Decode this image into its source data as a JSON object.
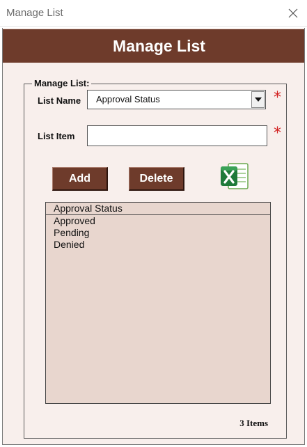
{
  "window": {
    "title": "Manage List"
  },
  "form": {
    "header": "Manage List",
    "group_label": "Manage List:",
    "list_name_label": "List Name",
    "list_name_value": "Approval Status",
    "list_item_label": "List Item",
    "list_item_value": "",
    "required_mark": "*",
    "add_button": "Add",
    "delete_button": "Delete",
    "listbox_header": "Approval Status",
    "items": [
      "Approved",
      "Pending",
      "Denied"
    ],
    "count_text": "3 Items"
  },
  "icons": {
    "close": "close-icon",
    "dropdown": "chevron-down-icon",
    "export": "excel-icon"
  },
  "colors": {
    "header_bg": "#6e3b2b",
    "form_bg": "#f8efec",
    "listbox_bg": "#e8d6ce",
    "required": "#d21f1f",
    "excel_green": "#1f7a3a"
  }
}
